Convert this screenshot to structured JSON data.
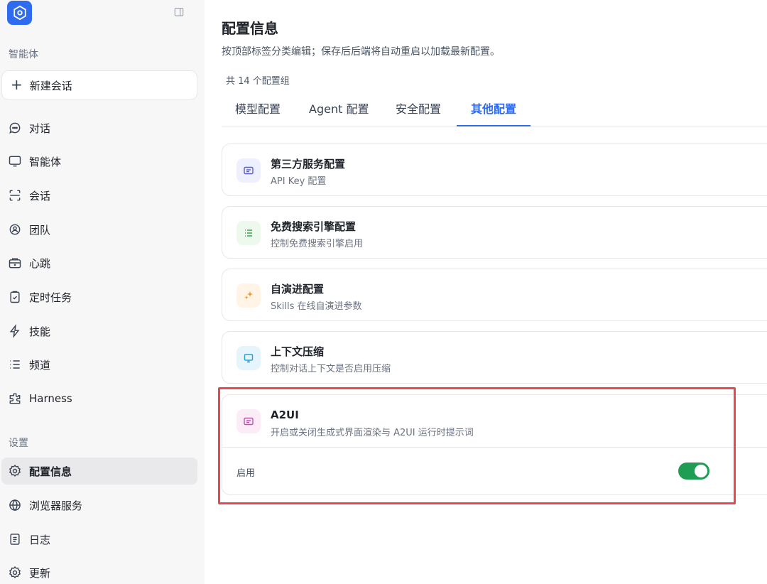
{
  "sidebar": {
    "section_agent": "智能体",
    "new_chat_label": "新建会话",
    "items": [
      {
        "label": "对话",
        "icon": "chat-bubble-icon"
      },
      {
        "label": "智能体",
        "icon": "monitor-icon"
      },
      {
        "label": "会话",
        "icon": "scan-icon"
      },
      {
        "label": "团队",
        "icon": "team-icon"
      },
      {
        "label": "心跳",
        "icon": "heartbeat-icon"
      },
      {
        "label": "定时任务",
        "icon": "clipboard-check-icon"
      },
      {
        "label": "技能",
        "icon": "lightning-icon"
      },
      {
        "label": "频道",
        "icon": "list-icon"
      },
      {
        "label": "Harness",
        "icon": "puzzle-icon"
      }
    ],
    "section_settings": "设置",
    "settings_items": [
      {
        "label": "配置信息",
        "icon": "gear-icon",
        "active": true
      },
      {
        "label": "浏览器服务",
        "icon": "globe-icon"
      },
      {
        "label": "日志",
        "icon": "document-icon"
      },
      {
        "label": "更新",
        "icon": "gear-icon"
      }
    ]
  },
  "main": {
    "title": "配置信息",
    "subtitle": "按顶部标签分类编辑；保存后后端将自动重启以加载最新配置。",
    "group_count": "共 14 个配置组",
    "tabs": [
      {
        "label": "模型配置",
        "active": false
      },
      {
        "label": "Agent 配置",
        "active": false
      },
      {
        "label": "安全配置",
        "active": false
      },
      {
        "label": "其他配置",
        "active": true
      }
    ],
    "cards": [
      {
        "title": "第三方服务配置",
        "desc": "API Key 配置",
        "icon": "key-card-icon",
        "icon_bg": "#eef0ff",
        "icon_color": "#5b5bd6"
      },
      {
        "title": "免费搜索引擎配置",
        "desc": "控制免费搜索引擎启用",
        "icon": "list-icon",
        "icon_bg": "#ecf9ec",
        "icon_color": "#3fa34d"
      },
      {
        "title": "自演进配置",
        "desc": "Skills 在线自演进参数",
        "icon": "sparkle-icon",
        "icon_bg": "#fff4e5",
        "icon_color": "#e89b2f"
      },
      {
        "title": "上下文压缩",
        "desc": "控制对话上下文是否启用压缩",
        "icon": "monitor-icon",
        "icon_bg": "#e6f4fb",
        "icon_color": "#2b9fd6"
      },
      {
        "title": "A2UI",
        "desc": "开启或关闭生成式界面渲染与 A2UI 运行时提示词",
        "icon": "message-card-icon",
        "icon_bg": "#fcecf7",
        "icon_color": "#c44fb0"
      }
    ],
    "a2ui_setting": {
      "label": "启用",
      "enabled": true,
      "toggle_color": "#1f9d55"
    }
  },
  "colors": {
    "accent": "#2f6bef",
    "highlight": "#e5484d"
  }
}
